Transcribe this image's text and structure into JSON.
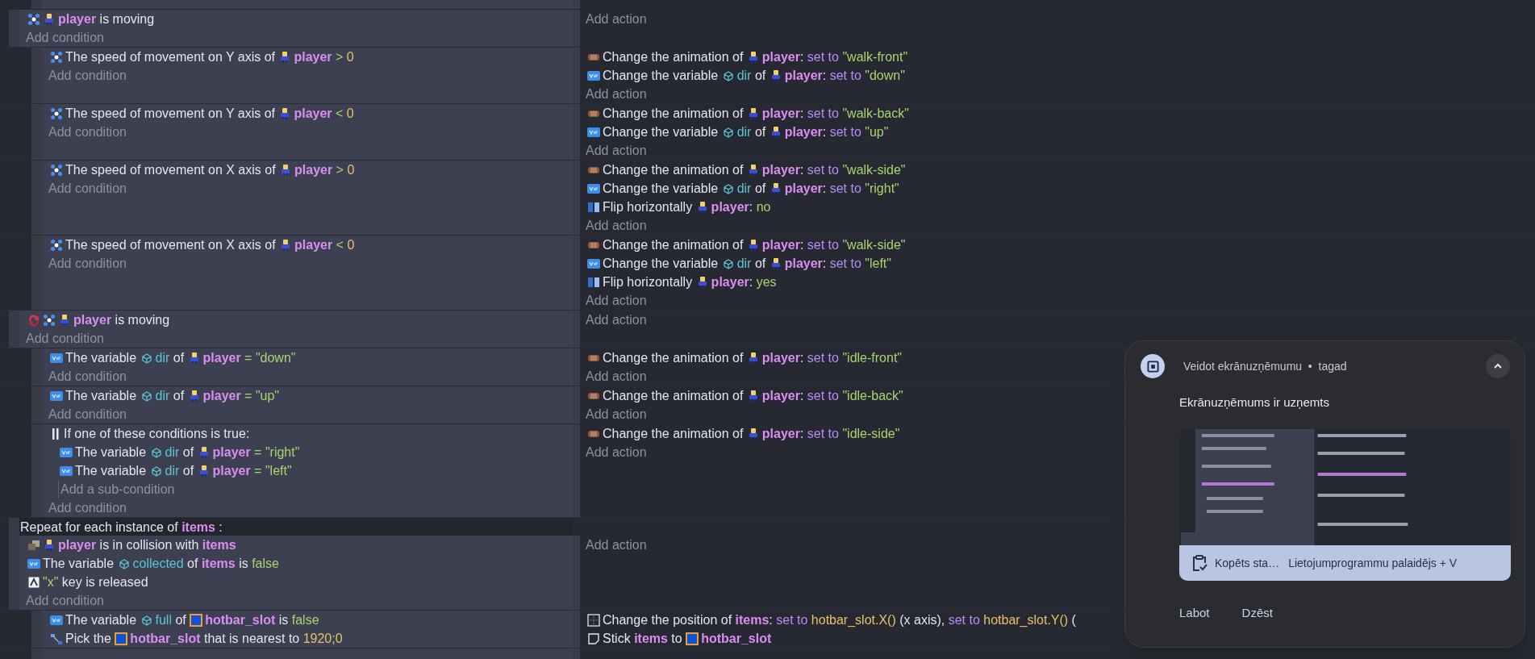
{
  "events": [
    {
      "kind": "fragment"
    },
    {
      "kind": "event",
      "conditions": [
        {
          "kind": "moving",
          "inverted": false,
          "tokens": [
            {
              "kind": "obj",
              "text": "player"
            },
            {
              "kind": "plain",
              "text": " is moving"
            }
          ]
        },
        {
          "kind": "add",
          "text": "Add condition"
        }
      ],
      "actions": [
        {
          "kind": "add",
          "text": "Add action"
        }
      ],
      "children": [
        {
          "kind": "event",
          "conditions": [
            {
              "kind": "speed",
              "inverted": false,
              "tokens": [
                {
                  "kind": "plain",
                  "text": "The speed of movement on Y axis of "
                },
                {
                  "kind": "obj",
                  "text": "player"
                },
                {
                  "kind": "op",
                  "text": " > "
                },
                {
                  "kind": "num",
                  "text": "0"
                }
              ]
            },
            {
              "kind": "add",
              "text": "Add condition"
            }
          ],
          "actions": [
            {
              "kind": "animation",
              "tokens": [
                {
                  "kind": "plain",
                  "text": "Change the animation of "
                },
                {
                  "kind": "obj",
                  "text": "player"
                },
                {
                  "kind": "plain",
                  "text": ": "
                },
                {
                  "kind": "kw",
                  "text": "set to "
                },
                {
                  "kind": "str",
                  "text": "\"walk-front\""
                }
              ]
            },
            {
              "kind": "variable",
              "tokens": [
                {
                  "kind": "plain",
                  "text": "Change the variable "
                },
                {
                  "kind": "var",
                  "text": "dir"
                },
                {
                  "kind": "plain",
                  "text": " of "
                },
                {
                  "kind": "obj",
                  "text": "player"
                },
                {
                  "kind": "plain",
                  "text": ": "
                },
                {
                  "kind": "kw",
                  "text": "set to "
                },
                {
                  "kind": "str",
                  "text": "\"down\""
                }
              ]
            },
            {
              "kind": "add",
              "text": "Add action"
            }
          ]
        },
        {
          "kind": "event",
          "conditions": [
            {
              "kind": "speed",
              "inverted": false,
              "tokens": [
                {
                  "kind": "plain",
                  "text": "The speed of movement on Y axis of "
                },
                {
                  "kind": "obj",
                  "text": "player"
                },
                {
                  "kind": "op",
                  "text": " < "
                },
                {
                  "kind": "num",
                  "text": "0"
                }
              ]
            },
            {
              "kind": "add",
              "text": "Add condition"
            }
          ],
          "actions": [
            {
              "kind": "animation",
              "tokens": [
                {
                  "kind": "plain",
                  "text": "Change the animation of "
                },
                {
                  "kind": "obj",
                  "text": "player"
                },
                {
                  "kind": "plain",
                  "text": ": "
                },
                {
                  "kind": "kw",
                  "text": "set to "
                },
                {
                  "kind": "str",
                  "text": "\"walk-back\""
                }
              ]
            },
            {
              "kind": "variable",
              "tokens": [
                {
                  "kind": "plain",
                  "text": "Change the variable "
                },
                {
                  "kind": "var",
                  "text": "dir"
                },
                {
                  "kind": "plain",
                  "text": " of "
                },
                {
                  "kind": "obj",
                  "text": "player"
                },
                {
                  "kind": "plain",
                  "text": ": "
                },
                {
                  "kind": "kw",
                  "text": "set to "
                },
                {
                  "kind": "str",
                  "text": "\"up\""
                }
              ]
            },
            {
              "kind": "add",
              "text": "Add action"
            }
          ]
        },
        {
          "kind": "event",
          "conditions": [
            {
              "kind": "speed",
              "inverted": false,
              "tokens": [
                {
                  "kind": "plain",
                  "text": "The speed of movement on X axis of "
                },
                {
                  "kind": "obj",
                  "text": "player"
                },
                {
                  "kind": "op",
                  "text": " > "
                },
                {
                  "kind": "num",
                  "text": "0"
                }
              ]
            },
            {
              "kind": "add",
              "text": "Add condition"
            }
          ],
          "actions": [
            {
              "kind": "animation",
              "tokens": [
                {
                  "kind": "plain",
                  "text": "Change the animation of "
                },
                {
                  "kind": "obj",
                  "text": "player"
                },
                {
                  "kind": "plain",
                  "text": ": "
                },
                {
                  "kind": "kw",
                  "text": "set to "
                },
                {
                  "kind": "str",
                  "text": "\"walk-side\""
                }
              ]
            },
            {
              "kind": "variable",
              "tokens": [
                {
                  "kind": "plain",
                  "text": "Change the variable "
                },
                {
                  "kind": "var",
                  "text": "dir"
                },
                {
                  "kind": "plain",
                  "text": " of "
                },
                {
                  "kind": "obj",
                  "text": "player"
                },
                {
                  "kind": "plain",
                  "text": ": "
                },
                {
                  "kind": "kw",
                  "text": "set to "
                },
                {
                  "kind": "str",
                  "text": "\"right\""
                }
              ]
            },
            {
              "kind": "flip",
              "tokens": [
                {
                  "kind": "plain",
                  "text": "Flip horizontally "
                },
                {
                  "kind": "obj",
                  "text": "player"
                },
                {
                  "kind": "plain",
                  "text": ": "
                },
                {
                  "kind": "str",
                  "text": "no"
                }
              ]
            },
            {
              "kind": "add",
              "text": "Add action"
            }
          ]
        },
        {
          "kind": "event",
          "conditions": [
            {
              "kind": "speed",
              "inverted": false,
              "tokens": [
                {
                  "kind": "plain",
                  "text": "The speed of movement on X axis of "
                },
                {
                  "kind": "obj",
                  "text": "player"
                },
                {
                  "kind": "op",
                  "text": " < "
                },
                {
                  "kind": "num",
                  "text": "0"
                }
              ]
            },
            {
              "kind": "add",
              "text": "Add condition"
            }
          ],
          "actions": [
            {
              "kind": "animation",
              "tokens": [
                {
                  "kind": "plain",
                  "text": "Change the animation of "
                },
                {
                  "kind": "obj",
                  "text": "player"
                },
                {
                  "kind": "plain",
                  "text": ": "
                },
                {
                  "kind": "kw",
                  "text": "set to "
                },
                {
                  "kind": "str",
                  "text": "\"walk-side\""
                }
              ]
            },
            {
              "kind": "variable",
              "tokens": [
                {
                  "kind": "plain",
                  "text": "Change the variable "
                },
                {
                  "kind": "var",
                  "text": "dir"
                },
                {
                  "kind": "plain",
                  "text": " of "
                },
                {
                  "kind": "obj",
                  "text": "player"
                },
                {
                  "kind": "plain",
                  "text": ": "
                },
                {
                  "kind": "kw",
                  "text": "set to "
                },
                {
                  "kind": "str",
                  "text": "\"left\""
                }
              ]
            },
            {
              "kind": "flip",
              "tokens": [
                {
                  "kind": "plain",
                  "text": "Flip horizontally "
                },
                {
                  "kind": "obj",
                  "text": "player"
                },
                {
                  "kind": "plain",
                  "text": ": "
                },
                {
                  "kind": "str",
                  "text": "yes"
                }
              ]
            },
            {
              "kind": "add",
              "text": "Add action"
            }
          ]
        }
      ]
    },
    {
      "kind": "event",
      "conditions": [
        {
          "kind": "moving",
          "inverted": true,
          "tokens": [
            {
              "kind": "obj",
              "text": "player"
            },
            {
              "kind": "plain",
              "text": " is moving"
            }
          ]
        },
        {
          "kind": "add",
          "text": "Add condition"
        }
      ],
      "actions": [
        {
          "kind": "add",
          "text": "Add action"
        }
      ],
      "children": [
        {
          "kind": "event",
          "conditions": [
            {
              "kind": "variable",
              "inverted": false,
              "tokens": [
                {
                  "kind": "plain",
                  "text": "The variable "
                },
                {
                  "kind": "var",
                  "text": "dir"
                },
                {
                  "kind": "plain",
                  "text": " of "
                },
                {
                  "kind": "obj",
                  "text": "player"
                },
                {
                  "kind": "op",
                  "text": " = "
                },
                {
                  "kind": "str",
                  "text": "\"down\""
                }
              ]
            },
            {
              "kind": "add",
              "text": "Add condition"
            }
          ],
          "actions": [
            {
              "kind": "animation",
              "tokens": [
                {
                  "kind": "plain",
                  "text": "Change the animation of "
                },
                {
                  "kind": "obj",
                  "text": "player"
                },
                {
                  "kind": "plain",
                  "text": ": "
                },
                {
                  "kind": "kw",
                  "text": "set to "
                },
                {
                  "kind": "str",
                  "text": "\"idle-front\""
                }
              ]
            },
            {
              "kind": "add",
              "text": "Add action"
            }
          ]
        },
        {
          "kind": "event",
          "conditions": [
            {
              "kind": "variable",
              "inverted": false,
              "tokens": [
                {
                  "kind": "plain",
                  "text": "The variable "
                },
                {
                  "kind": "var",
                  "text": "dir"
                },
                {
                  "kind": "plain",
                  "text": " of "
                },
                {
                  "kind": "obj",
                  "text": "player"
                },
                {
                  "kind": "op",
                  "text": " = "
                },
                {
                  "kind": "str",
                  "text": "\"up\""
                }
              ]
            },
            {
              "kind": "add",
              "text": "Add condition"
            }
          ],
          "actions": [
            {
              "kind": "animation",
              "tokens": [
                {
                  "kind": "plain",
                  "text": "Change the animation of "
                },
                {
                  "kind": "obj",
                  "text": "player"
                },
                {
                  "kind": "plain",
                  "text": ": "
                },
                {
                  "kind": "kw",
                  "text": "set to "
                },
                {
                  "kind": "str",
                  "text": "\"idle-back\""
                }
              ]
            },
            {
              "kind": "add",
              "text": "Add action"
            }
          ]
        },
        {
          "kind": "event",
          "conditions": [
            {
              "kind": "or",
              "text": "If one of these conditions is true:",
              "lines": [
                {
                  "kind": "variable",
                  "inverted": false,
                  "tokens": [
                    {
                      "kind": "plain",
                      "text": "The variable "
                    },
                    {
                      "kind": "var",
                      "text": "dir"
                    },
                    {
                      "kind": "plain",
                      "text": " of "
                    },
                    {
                      "kind": "obj",
                      "text": "player"
                    },
                    {
                      "kind": "op",
                      "text": " = "
                    },
                    {
                      "kind": "str",
                      "text": "\"right\""
                    }
                  ]
                },
                {
                  "kind": "variable",
                  "inverted": false,
                  "tokens": [
                    {
                      "kind": "plain",
                      "text": "The variable "
                    },
                    {
                      "kind": "var",
                      "text": "dir"
                    },
                    {
                      "kind": "plain",
                      "text": " of "
                    },
                    {
                      "kind": "obj",
                      "text": "player"
                    },
                    {
                      "kind": "op",
                      "text": " = "
                    },
                    {
                      "kind": "str",
                      "text": "\"left\""
                    }
                  ]
                }
              ],
              "add": "Add a sub-condition"
            },
            {
              "kind": "add",
              "text": "Add condition"
            }
          ],
          "actions": [
            {
              "kind": "animation",
              "tokens": [
                {
                  "kind": "plain",
                  "text": "Change the animation of "
                },
                {
                  "kind": "obj",
                  "text": "player"
                },
                {
                  "kind": "plain",
                  "text": ": "
                },
                {
                  "kind": "kw",
                  "text": "set to "
                },
                {
                  "kind": "str",
                  "text": "\"idle-side\""
                }
              ]
            },
            {
              "kind": "add",
              "text": "Add action"
            }
          ]
        }
      ]
    },
    {
      "kind": "repeat",
      "header": [
        {
          "kind": "plain",
          "text": "Repeat for each instance of "
        },
        {
          "kind": "name",
          "text": "items"
        },
        {
          "kind": "plain",
          "text": " :"
        }
      ],
      "conditions": [
        {
          "kind": "collision",
          "inverted": false,
          "tokens": [
            {
              "kind": "obj",
              "text": "player"
            },
            {
              "kind": "plain",
              "text": " is in collision with "
            },
            {
              "kind": "name",
              "text": "items"
            }
          ]
        },
        {
          "kind": "variable",
          "inverted": false,
          "tokens": [
            {
              "kind": "plain",
              "text": "The variable "
            },
            {
              "kind": "var",
              "text": "collected"
            },
            {
              "kind": "plain",
              "text": " of "
            },
            {
              "kind": "name",
              "text": "items"
            },
            {
              "kind": "plain",
              "text": " is "
            },
            {
              "kind": "str",
              "text": "false"
            }
          ]
        },
        {
          "kind": "key",
          "inverted": false,
          "tokens": [
            {
              "kind": "str",
              "text": "\"x\""
            },
            {
              "kind": "plain",
              "text": " key is released"
            }
          ]
        },
        {
          "kind": "add",
          "text": "Add condition"
        }
      ],
      "actions": [
        {
          "kind": "add",
          "text": "Add action"
        }
      ],
      "children": [
        {
          "kind": "event",
          "conditions": [
            {
              "kind": "variable",
              "inverted": false,
              "tokens": [
                {
                  "kind": "plain",
                  "text": "The variable "
                },
                {
                  "kind": "var",
                  "text": "full"
                },
                {
                  "kind": "plain",
                  "text": " of "
                },
                {
                  "kind": "slot",
                  "text": "hotbar_slot"
                },
                {
                  "kind": "plain",
                  "text": " is "
                },
                {
                  "kind": "str",
                  "text": "false"
                }
              ]
            },
            {
              "kind": "pick",
              "inverted": false,
              "tokens": [
                {
                  "kind": "plain",
                  "text": "Pick the "
                },
                {
                  "kind": "slot",
                  "text": "hotbar_slot"
                },
                {
                  "kind": "plain",
                  "text": " that is nearest to "
                },
                {
                  "kind": "num",
                  "text": "1920;0"
                }
              ]
            }
          ],
          "actions": [
            {
              "kind": "position",
              "tokens": [
                {
                  "kind": "plain",
                  "text": "Change the position of "
                },
                {
                  "kind": "name",
                  "text": "items"
                },
                {
                  "kind": "plain",
                  "text": ": "
                },
                {
                  "kind": "kw",
                  "text": "set to "
                },
                {
                  "kind": "num",
                  "text": "hotbar_slot.X()"
                },
                {
                  "kind": "plain",
                  "text": " (x axis), "
                },
                {
                  "kind": "kw",
                  "text": "set to "
                },
                {
                  "kind": "num",
                  "text": "hotbar_slot.Y()"
                },
                {
                  "kind": "plain",
                  "text": " ("
                }
              ]
            },
            {
              "kind": "stick",
              "tokens": [
                {
                  "kind": "plain",
                  "text": "Stick "
                },
                {
                  "kind": "name",
                  "text": "items"
                },
                {
                  "kind": "plain",
                  "text": " to "
                },
                {
                  "kind": "slot",
                  "text": "hotbar_slot"
                }
              ]
            }
          ]
        }
      ]
    }
  ],
  "notification": {
    "app": "Veidot ekrānuzņēmumu",
    "separator": "•",
    "time": "tagad",
    "title": "Ekrānuzņēmums ir uzņemts",
    "clipboard": "Kopēts sta…",
    "shortcut": "Lietojumprogrammu palaidējs + V",
    "buttons": [
      "Labot",
      "Dzēst"
    ]
  }
}
